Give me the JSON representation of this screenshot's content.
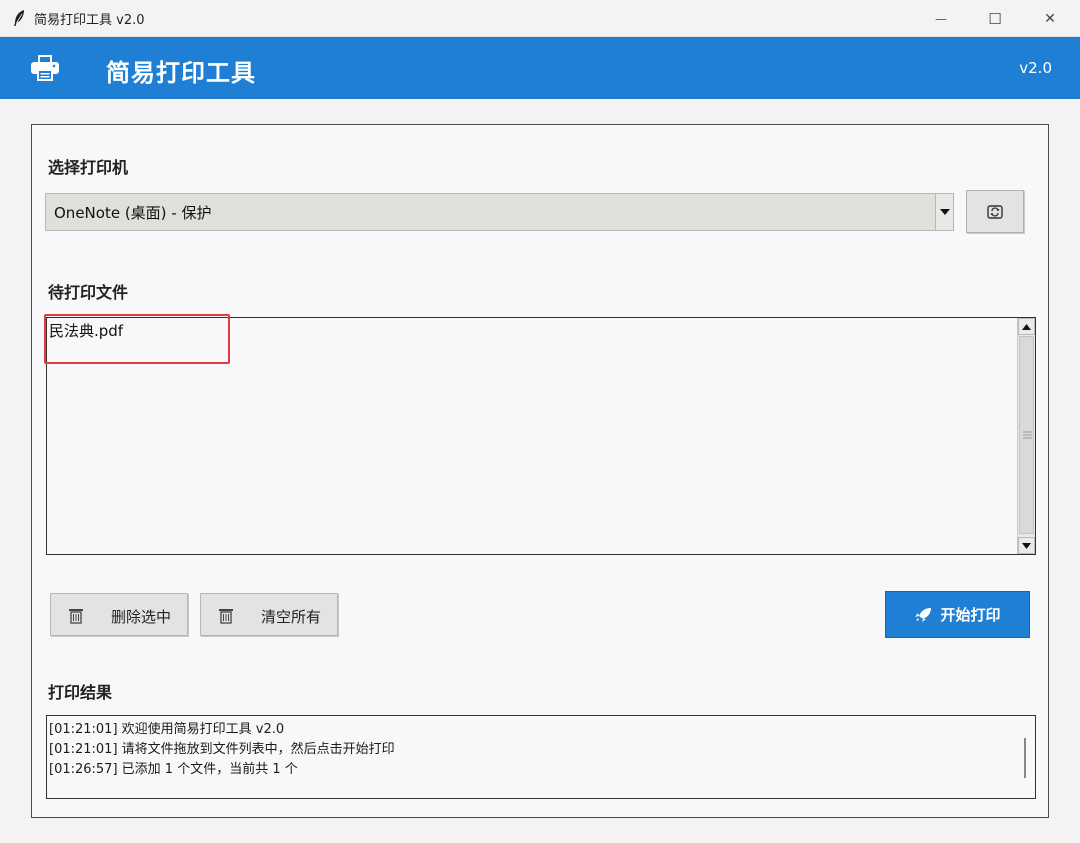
{
  "window": {
    "title": "简易打印工具 v2.0",
    "minimize_glyph": "—",
    "maximize_glyph": "☐",
    "close_glyph": "✕"
  },
  "header": {
    "title": "简易打印工具",
    "version": "v2.0"
  },
  "printer_section": {
    "label": "选择打印机",
    "selected": "OneNote (桌面) - 保护"
  },
  "files_section": {
    "label": "待打印文件",
    "files": [
      "民法典.pdf"
    ]
  },
  "buttons": {
    "delete_selected": "删除选中",
    "clear_all": "清空所有",
    "start_print": "开始打印"
  },
  "result_section": {
    "label": "打印结果",
    "log": [
      "[01:21:01] 欢迎使用简易打印工具 v2.0",
      "[01:21:01] 请将文件拖放到文件列表中，然后点击开始打印",
      "[01:26:57] 已添加 1 个文件，当前共 1 个"
    ]
  },
  "colors": {
    "accent": "#1f7fd4",
    "highlight": "#e33b3b"
  }
}
